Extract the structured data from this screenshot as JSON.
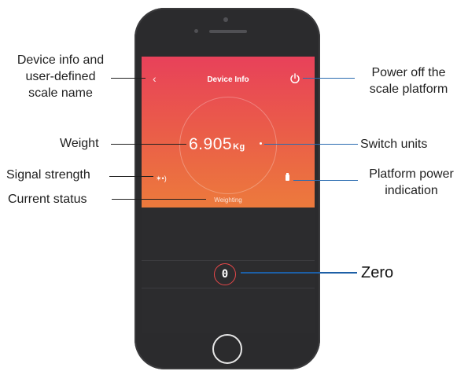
{
  "app": {
    "title": "Device Info",
    "weight_value": "6.905",
    "weight_unit": "Kg",
    "status": "Weighting",
    "zero_symbol": "0"
  },
  "callouts": {
    "device_info": [
      "Device info and",
      "user-defined",
      "scale name"
    ],
    "weight": "Weight",
    "signal": "Signal strength",
    "status": "Current status",
    "power_off": [
      "Power off the",
      "scale platform"
    ],
    "switch_units": "Switch units",
    "platform_power": [
      "Platform power",
      "indication"
    ],
    "zero": "Zero"
  },
  "icons": {
    "back": "back-chevron-icon",
    "power": "power-icon",
    "bluetooth": "bluetooth-signal-icon",
    "battery": "battery-icon",
    "home": "home-button-icon"
  },
  "colors": {
    "gradient_top": "#e8415a",
    "gradient_bottom": "#ec7a3c",
    "zero_ring": "#e8484a",
    "callout_line_blue": "#2a6bb0",
    "zero_line": "#1d5fa6"
  }
}
